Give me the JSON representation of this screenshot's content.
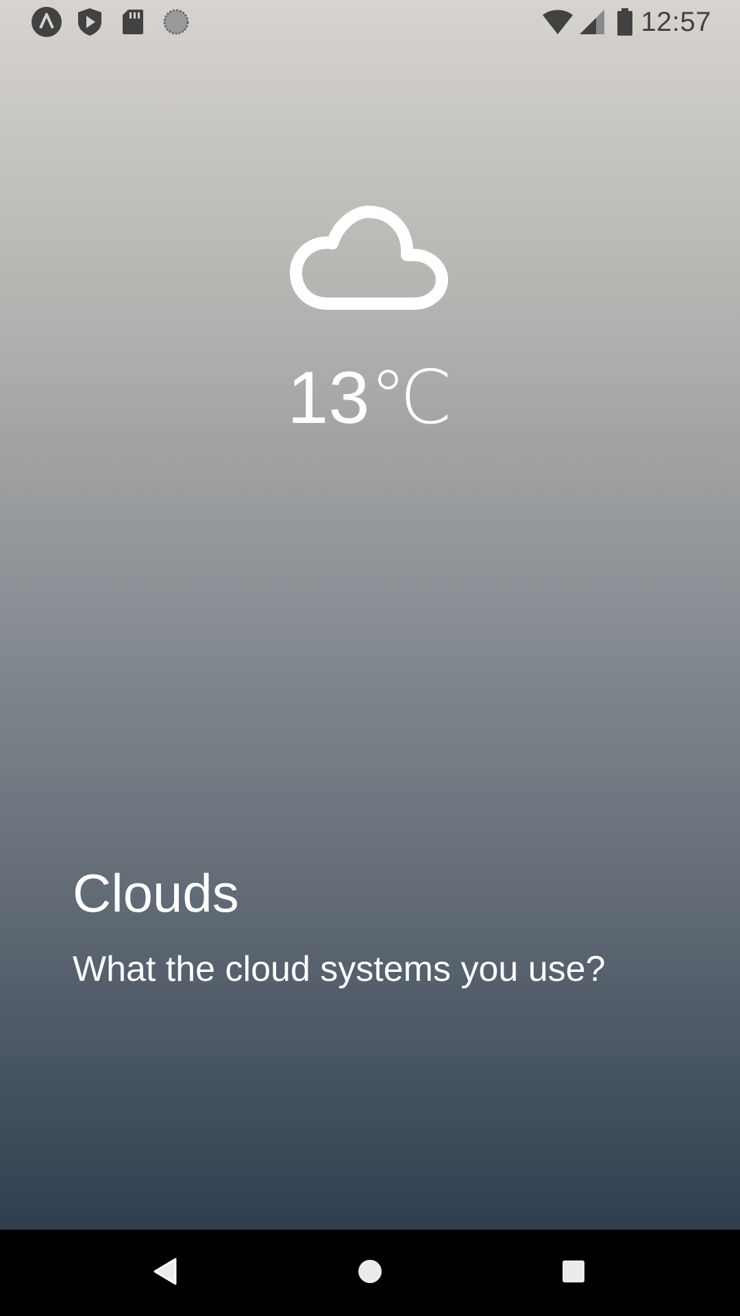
{
  "status_bar": {
    "time": "12:57",
    "left_icons": [
      "app-logo-icon",
      "shield-play-icon",
      "sd-card-icon",
      "sync-circle-icon"
    ],
    "right_icons": [
      "wifi-icon",
      "cell-signal-icon",
      "battery-icon"
    ]
  },
  "weather": {
    "icon": "cloud-icon",
    "temperature": "13℃"
  },
  "content": {
    "title": "Clouds",
    "question": "What the cloud systems you use?"
  },
  "nav_bar": {
    "buttons": [
      "back-icon",
      "home-icon",
      "recents-icon"
    ]
  },
  "colors": {
    "gradient_top": "#d7d4cf",
    "gradient_bottom": "#2f3f4f",
    "text": "#ffffff",
    "status_icons": "#424242"
  }
}
